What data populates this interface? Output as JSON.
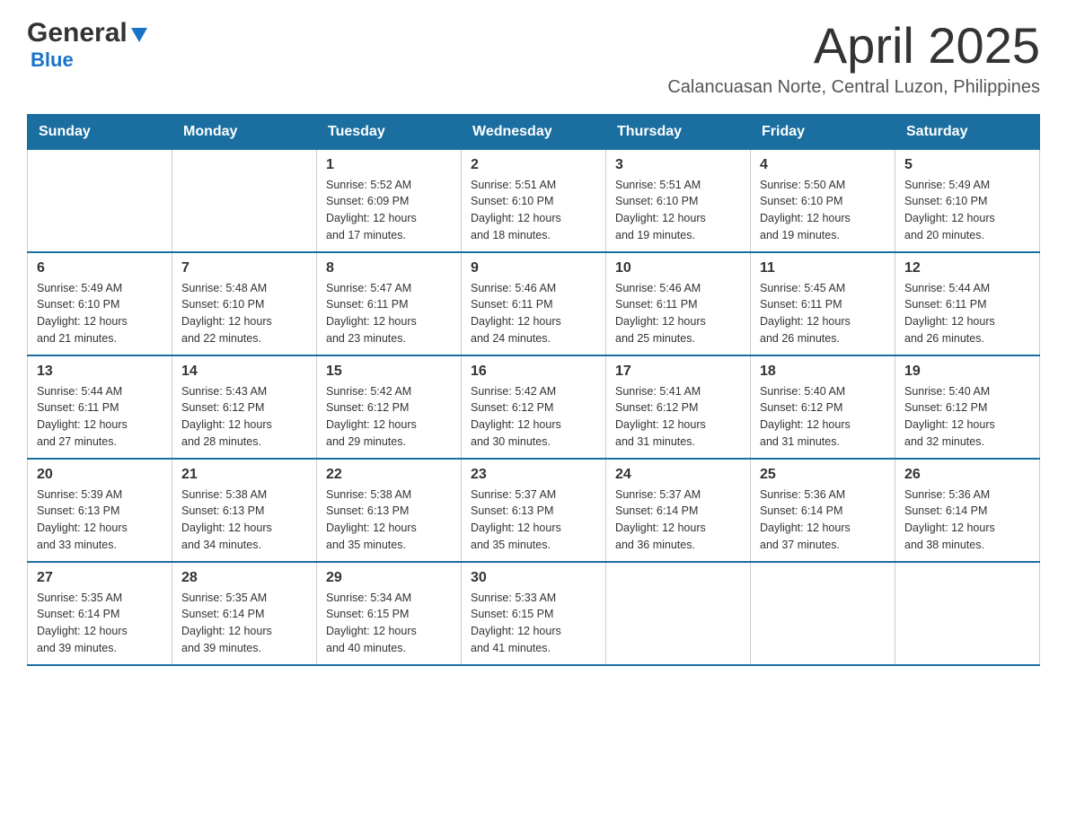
{
  "header": {
    "logo_general": "General",
    "logo_blue": "Blue",
    "month_title": "April 2025",
    "location": "Calancuasan Norte, Central Luzon, Philippines"
  },
  "calendar": {
    "days_of_week": [
      "Sunday",
      "Monday",
      "Tuesday",
      "Wednesday",
      "Thursday",
      "Friday",
      "Saturday"
    ],
    "weeks": [
      [
        {
          "day": "",
          "info": ""
        },
        {
          "day": "",
          "info": ""
        },
        {
          "day": "1",
          "info": "Sunrise: 5:52 AM\nSunset: 6:09 PM\nDaylight: 12 hours\nand 17 minutes."
        },
        {
          "day": "2",
          "info": "Sunrise: 5:51 AM\nSunset: 6:10 PM\nDaylight: 12 hours\nand 18 minutes."
        },
        {
          "day": "3",
          "info": "Sunrise: 5:51 AM\nSunset: 6:10 PM\nDaylight: 12 hours\nand 19 minutes."
        },
        {
          "day": "4",
          "info": "Sunrise: 5:50 AM\nSunset: 6:10 PM\nDaylight: 12 hours\nand 19 minutes."
        },
        {
          "day": "5",
          "info": "Sunrise: 5:49 AM\nSunset: 6:10 PM\nDaylight: 12 hours\nand 20 minutes."
        }
      ],
      [
        {
          "day": "6",
          "info": "Sunrise: 5:49 AM\nSunset: 6:10 PM\nDaylight: 12 hours\nand 21 minutes."
        },
        {
          "day": "7",
          "info": "Sunrise: 5:48 AM\nSunset: 6:10 PM\nDaylight: 12 hours\nand 22 minutes."
        },
        {
          "day": "8",
          "info": "Sunrise: 5:47 AM\nSunset: 6:11 PM\nDaylight: 12 hours\nand 23 minutes."
        },
        {
          "day": "9",
          "info": "Sunrise: 5:46 AM\nSunset: 6:11 PM\nDaylight: 12 hours\nand 24 minutes."
        },
        {
          "day": "10",
          "info": "Sunrise: 5:46 AM\nSunset: 6:11 PM\nDaylight: 12 hours\nand 25 minutes."
        },
        {
          "day": "11",
          "info": "Sunrise: 5:45 AM\nSunset: 6:11 PM\nDaylight: 12 hours\nand 26 minutes."
        },
        {
          "day": "12",
          "info": "Sunrise: 5:44 AM\nSunset: 6:11 PM\nDaylight: 12 hours\nand 26 minutes."
        }
      ],
      [
        {
          "day": "13",
          "info": "Sunrise: 5:44 AM\nSunset: 6:11 PM\nDaylight: 12 hours\nand 27 minutes."
        },
        {
          "day": "14",
          "info": "Sunrise: 5:43 AM\nSunset: 6:12 PM\nDaylight: 12 hours\nand 28 minutes."
        },
        {
          "day": "15",
          "info": "Sunrise: 5:42 AM\nSunset: 6:12 PM\nDaylight: 12 hours\nand 29 minutes."
        },
        {
          "day": "16",
          "info": "Sunrise: 5:42 AM\nSunset: 6:12 PM\nDaylight: 12 hours\nand 30 minutes."
        },
        {
          "day": "17",
          "info": "Sunrise: 5:41 AM\nSunset: 6:12 PM\nDaylight: 12 hours\nand 31 minutes."
        },
        {
          "day": "18",
          "info": "Sunrise: 5:40 AM\nSunset: 6:12 PM\nDaylight: 12 hours\nand 31 minutes."
        },
        {
          "day": "19",
          "info": "Sunrise: 5:40 AM\nSunset: 6:12 PM\nDaylight: 12 hours\nand 32 minutes."
        }
      ],
      [
        {
          "day": "20",
          "info": "Sunrise: 5:39 AM\nSunset: 6:13 PM\nDaylight: 12 hours\nand 33 minutes."
        },
        {
          "day": "21",
          "info": "Sunrise: 5:38 AM\nSunset: 6:13 PM\nDaylight: 12 hours\nand 34 minutes."
        },
        {
          "day": "22",
          "info": "Sunrise: 5:38 AM\nSunset: 6:13 PM\nDaylight: 12 hours\nand 35 minutes."
        },
        {
          "day": "23",
          "info": "Sunrise: 5:37 AM\nSunset: 6:13 PM\nDaylight: 12 hours\nand 35 minutes."
        },
        {
          "day": "24",
          "info": "Sunrise: 5:37 AM\nSunset: 6:14 PM\nDaylight: 12 hours\nand 36 minutes."
        },
        {
          "day": "25",
          "info": "Sunrise: 5:36 AM\nSunset: 6:14 PM\nDaylight: 12 hours\nand 37 minutes."
        },
        {
          "day": "26",
          "info": "Sunrise: 5:36 AM\nSunset: 6:14 PM\nDaylight: 12 hours\nand 38 minutes."
        }
      ],
      [
        {
          "day": "27",
          "info": "Sunrise: 5:35 AM\nSunset: 6:14 PM\nDaylight: 12 hours\nand 39 minutes."
        },
        {
          "day": "28",
          "info": "Sunrise: 5:35 AM\nSunset: 6:14 PM\nDaylight: 12 hours\nand 39 minutes."
        },
        {
          "day": "29",
          "info": "Sunrise: 5:34 AM\nSunset: 6:15 PM\nDaylight: 12 hours\nand 40 minutes."
        },
        {
          "day": "30",
          "info": "Sunrise: 5:33 AM\nSunset: 6:15 PM\nDaylight: 12 hours\nand 41 minutes."
        },
        {
          "day": "",
          "info": ""
        },
        {
          "day": "",
          "info": ""
        },
        {
          "day": "",
          "info": ""
        }
      ]
    ]
  }
}
